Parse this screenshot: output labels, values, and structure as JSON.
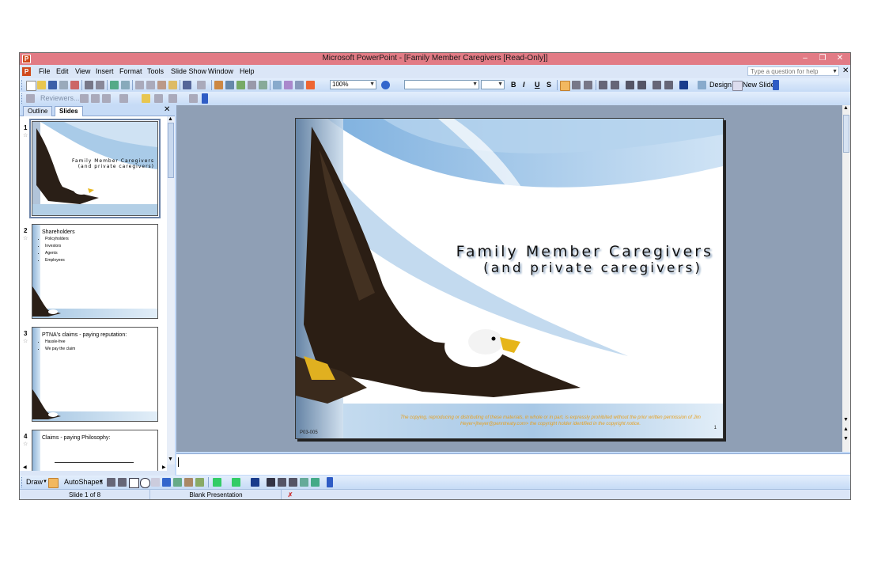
{
  "window": {
    "title": "Microsoft PowerPoint - [Family Member Caregivers [Read-Only]]",
    "minimize": "–",
    "restore": "❐",
    "close": "✕"
  },
  "menubar": {
    "items": [
      "File",
      "Edit",
      "View",
      "Insert",
      "Format",
      "Tools",
      "Slide Show",
      "Window",
      "Help"
    ],
    "help_placeholder": "Type a question for help",
    "close": "✕"
  },
  "toolbar": {
    "zoom": "100%",
    "bold": "B",
    "italic": "I",
    "underline": "U",
    "shadow": "S",
    "design_label": "Design",
    "new_slide_label": "New Slide",
    "reviewers_label": "Reviewers..."
  },
  "left_pane": {
    "tabs": [
      "Outline",
      "Slides"
    ],
    "active_tab": "Slides",
    "close": "✕",
    "slides": [
      {
        "number": "1",
        "title": "Family Member Caregivers",
        "subtitle": "(and private caregivers)",
        "bullets": []
      },
      {
        "number": "2",
        "title": "Shareholders",
        "bullets": [
          "Policyholders",
          "Investors",
          "Agents",
          "Employees"
        ]
      },
      {
        "number": "3",
        "title": "PTNA's claims - paying reputation:",
        "bullets": [
          "Hassle-free",
          "We pay the claim"
        ]
      },
      {
        "number": "4",
        "title": "Claims - paying Philosophy:",
        "bullets": []
      }
    ]
  },
  "slide": {
    "title_line1": "Family Member Caregivers",
    "title_line2": "(and private caregivers)",
    "copyright": "The copying, reproducing or distributing of these materials, in whole or in part, is expressly prohibited without the prior written permission of Jim Heyer<jheyer@penntreaty.com> the copyright holder identified in the copyright notice.",
    "code": "P03-005",
    "page_number": "1"
  },
  "drawbar": {
    "draw_label": "Draw",
    "autoshapes_label": "AutoShapes"
  },
  "status": {
    "slide_info": "Slide 1 of 8",
    "design": "Blank Presentation"
  },
  "colors": {
    "titlebar": "#e27b85",
    "chrome": "#c3daf9",
    "canvas": "#8f9fb5"
  }
}
